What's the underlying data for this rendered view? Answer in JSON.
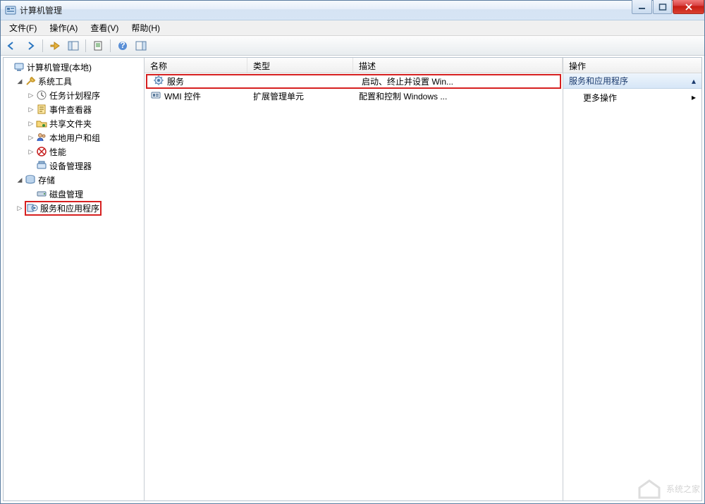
{
  "window": {
    "title": "计算机管理"
  },
  "menu": {
    "file": "文件(F)",
    "action": "操作(A)",
    "view": "查看(V)",
    "help": "帮助(H)"
  },
  "tree": {
    "root": "计算机管理(本地)",
    "sys_tools": "系统工具",
    "task_sched": "任务计划程序",
    "event_viewer": "事件查看器",
    "shared_folders": "共享文件夹",
    "local_users": "本地用户和组",
    "performance": "性能",
    "device_mgr": "设备管理器",
    "storage": "存储",
    "disk_mgmt": "磁盘管理",
    "services_apps": "服务和应用程序"
  },
  "list": {
    "hdr_name": "名称",
    "hdr_type": "类型",
    "hdr_desc": "描述",
    "rows": [
      {
        "name": "服务",
        "type": "",
        "desc": "启动、终止并设置 Win..."
      },
      {
        "name": "WMI 控件",
        "type": "扩展管理单元",
        "desc": "配置和控制 Windows ..."
      }
    ]
  },
  "actions": {
    "header": "操作",
    "category": "服务和应用程序",
    "more": "更多操作"
  },
  "watermark": "系统之家"
}
